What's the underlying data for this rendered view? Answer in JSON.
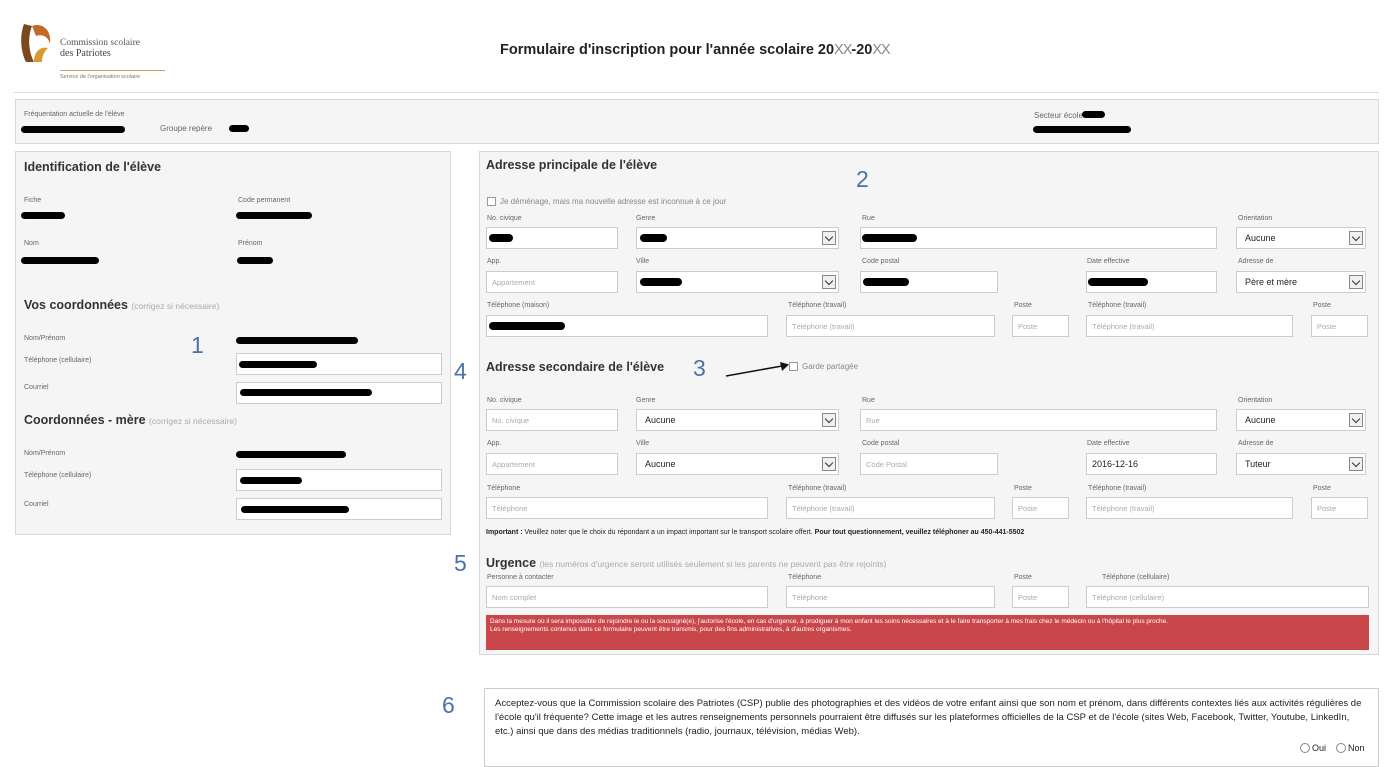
{
  "header": {
    "org_line1": "Commission scolaire",
    "org_line2": "des Patriotes",
    "org_sub": "Service de l'organisation scolaire",
    "title_main": "Formulaire d'inscription pour l'année scolaire 20",
    "title_mid": "-20",
    "title_placeholder": "XX"
  },
  "top_bar": {
    "frequentation_label": "Fréquentation actuelle de l'élève",
    "groupe_label": "Groupe repère",
    "secteur_label": "Secteur école :"
  },
  "identification": {
    "title": "Identification de l'élève",
    "fiche_label": "Fiche",
    "code_permanent_label": "Code permanent",
    "nom_label": "Nom",
    "prenom_label": "Prénom"
  },
  "coordonnees": {
    "title": "Vos coordonnées",
    "note": "(corrigez si nécessaire)",
    "nom_prenom_label": "Nom/Prénom",
    "telephone_label": "Téléphone (cellulaire)",
    "courriel_label": "Courriel"
  },
  "coordonnees_mere": {
    "title": "Coordonnées - mère",
    "note": "(corrigez si nécessaire)",
    "nom_prenom_label": "Nom/Prénom",
    "telephone_label": "Téléphone (cellulaire)",
    "courriel_label": "Courriel"
  },
  "adresse_principale": {
    "title": "Adresse principale de l'élève",
    "demenage_label": "Je déménage, mais ma nouvelle adresse est inconnue à ce jour",
    "no_civique_label": "No. civique",
    "genre_label": "Genre",
    "rue_label": "Rue",
    "orientation_label": "Orientation",
    "orientation_value": "Aucune",
    "app_label": "App.",
    "app_placeholder": "Appartement",
    "ville_label": "Ville",
    "code_postal_label": "Code postal",
    "date_effective_label": "Date effective",
    "adresse_de_label": "Adresse de",
    "adresse_de_value": "Père et mère",
    "tel_maison_label": "Téléphone (maison)",
    "tel_travail_label": "Téléphone (travail)",
    "tel_travail_placeholder": "Téléphone (travail)",
    "poste_label": "Poste",
    "poste_placeholder": "Poste"
  },
  "adresse_secondaire": {
    "title": "Adresse secondaire de l'élève",
    "garde_label": "Garde partagée",
    "no_civique_label": "No. civique",
    "no_civique_placeholder": "No. civique",
    "genre_label": "Genre",
    "genre_value": "Aucune",
    "rue_label": "Rue",
    "rue_placeholder": "Rue",
    "orientation_label": "Orientation",
    "orientation_value": "Aucune",
    "app_label": "App.",
    "app_placeholder": "Appartement",
    "ville_label": "Ville",
    "ville_value": "Aucune",
    "code_postal_label": "Code postal",
    "code_postal_placeholder": "Code Postal",
    "date_effective_label": "Date effective",
    "date_effective_value": "2016-12-16",
    "adresse_de_label": "Adresse de",
    "adresse_de_value": "Tuteur",
    "telephone_label": "Téléphone",
    "telephone_placeholder": "Téléphone",
    "tel_travail_label": "Téléphone (travail)",
    "tel_travail_placeholder": "Téléphone (travail)",
    "poste_label": "Poste",
    "poste_placeholder": "Poste"
  },
  "important": {
    "prefix": "Important :",
    "text": " Veuillez noter que le choix du répondant a un impact important sur le transport scolaire offert. ",
    "bold": "Pour tout questionnement, veuillez téléphoner au 450-441-5502"
  },
  "urgence": {
    "title": "Urgence",
    "note": "(les numéros d'urgence seront utilisés seulement si les parents ne peuvent pas être rejoints)",
    "personne_label": "Personne à contacter",
    "personne_placeholder": "Nom complet",
    "telephone_label": "Téléphone",
    "telephone_placeholder": "Téléphone",
    "poste_label": "Poste",
    "poste_placeholder": "Poste",
    "cell_label": "Téléphone (cellulaire)",
    "cell_placeholder": "Téléphone (cellulaire)",
    "warning_line1": "Dans la mesure où il sera impossible de rejoindre le ou la soussigné(e), j'autorise l'école, en cas d'urgence, à prodiguer à mon enfant les soins nécessaires et à le faire transporter à mes frais chez le médecin ou à l'hôpital le plus proche.",
    "warning_line2": "Les renseignements contenus dans ce formulaire peuvent être transmis, pour des fins administratives, à d'autres organismes."
  },
  "consent": {
    "text": "Acceptez-vous que la Commission scolaire des Patriotes (CSP) publie des photographies et des vidéos de votre enfant ainsi que son nom et prénom, dans différents contextes liés aux activités régulières de l'école qu'il fréquente? Cette image et les autres renseignements personnels pourraient être diffusés sur les plateformes officielles de la CSP et de l'école (sites Web, Facebook, Twitter, Youtube, LinkedIn, etc.) ainsi que dans des médias traditionnels (radio, journaux, télévision, médias Web).",
    "oui": "Oui",
    "non": "Non"
  },
  "annotations": [
    "1",
    "2",
    "3",
    "4",
    "5",
    "6"
  ]
}
